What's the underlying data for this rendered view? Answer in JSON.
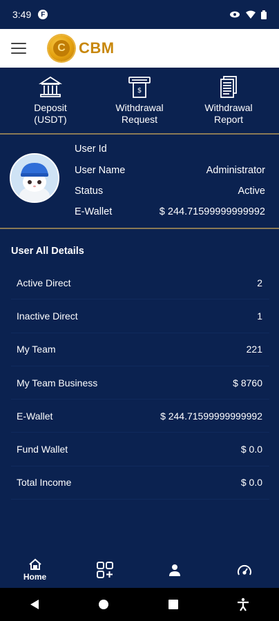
{
  "status_bar": {
    "time": "3:49"
  },
  "header": {
    "brand": "CBM",
    "logo_letter": "C"
  },
  "actions": [
    {
      "label": "Deposit\n(USDT)",
      "icon": "bank-icon"
    },
    {
      "label": "Withdrawal\nRequest",
      "icon": "atm-icon"
    },
    {
      "label": "Withdrawal\nReport",
      "icon": "report-icon"
    }
  ],
  "profile": {
    "user_id_label": "User Id",
    "user_id_value": "",
    "user_name_label": "User Name",
    "user_name_value": "Administrator",
    "status_label": "Status",
    "status_value": "Active",
    "ewallet_label": "E-Wallet",
    "ewallet_value": "$ 244.71599999999992"
  },
  "details": {
    "title": "User All Details",
    "rows": [
      {
        "label": "Active Direct",
        "value": "2"
      },
      {
        "label": "Inactive Direct",
        "value": "1"
      },
      {
        "label": "My Team",
        "value": "221"
      },
      {
        "label": "My Team Business",
        "value": "$ 8760"
      },
      {
        "label": "E-Wallet",
        "value": "$ 244.71599999999992"
      },
      {
        "label": "Fund Wallet",
        "value": "$ 0.0"
      },
      {
        "label": "Total Income",
        "value": "$ 0.0"
      }
    ]
  },
  "bottom_nav": {
    "home_label": "Home"
  }
}
